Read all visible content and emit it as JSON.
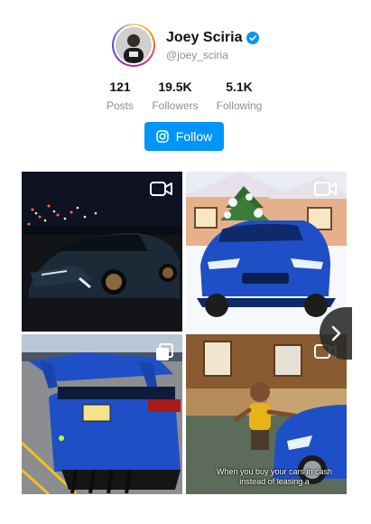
{
  "profile": {
    "display_name": "Joey Sciria",
    "username": "@joey_sciria",
    "verified": true
  },
  "stats": [
    {
      "value": "121",
      "label": "Posts"
    },
    {
      "value": "19.5K",
      "label": "Followers"
    },
    {
      "value": "5.1K",
      "label": "Following"
    }
  ],
  "follow_button": {
    "label": "Follow",
    "icon": "instagram-icon"
  },
  "posts": [
    {
      "type": "video",
      "icon": "video-camera-icon",
      "description_icon": "night-car-with-christmas-lights"
    },
    {
      "type": "video",
      "icon": "video-camera-icon",
      "description_icon": "cartoon-car-with-tree-on-roof"
    },
    {
      "type": "carousel",
      "icon": "carousel-icon",
      "description_icon": "car-rear-spoiler-parking-lot"
    },
    {
      "type": "video",
      "icon": "video-camera-icon",
      "caption": "When you buy your cars in cash instead of leasing a"
    }
  ],
  "colors": {
    "accent": "#0095f6",
    "car_blue": "#1f4fc7",
    "muted_text": "#8e8e8e"
  },
  "carousel_next": {
    "icon": "chevron-right-icon"
  }
}
